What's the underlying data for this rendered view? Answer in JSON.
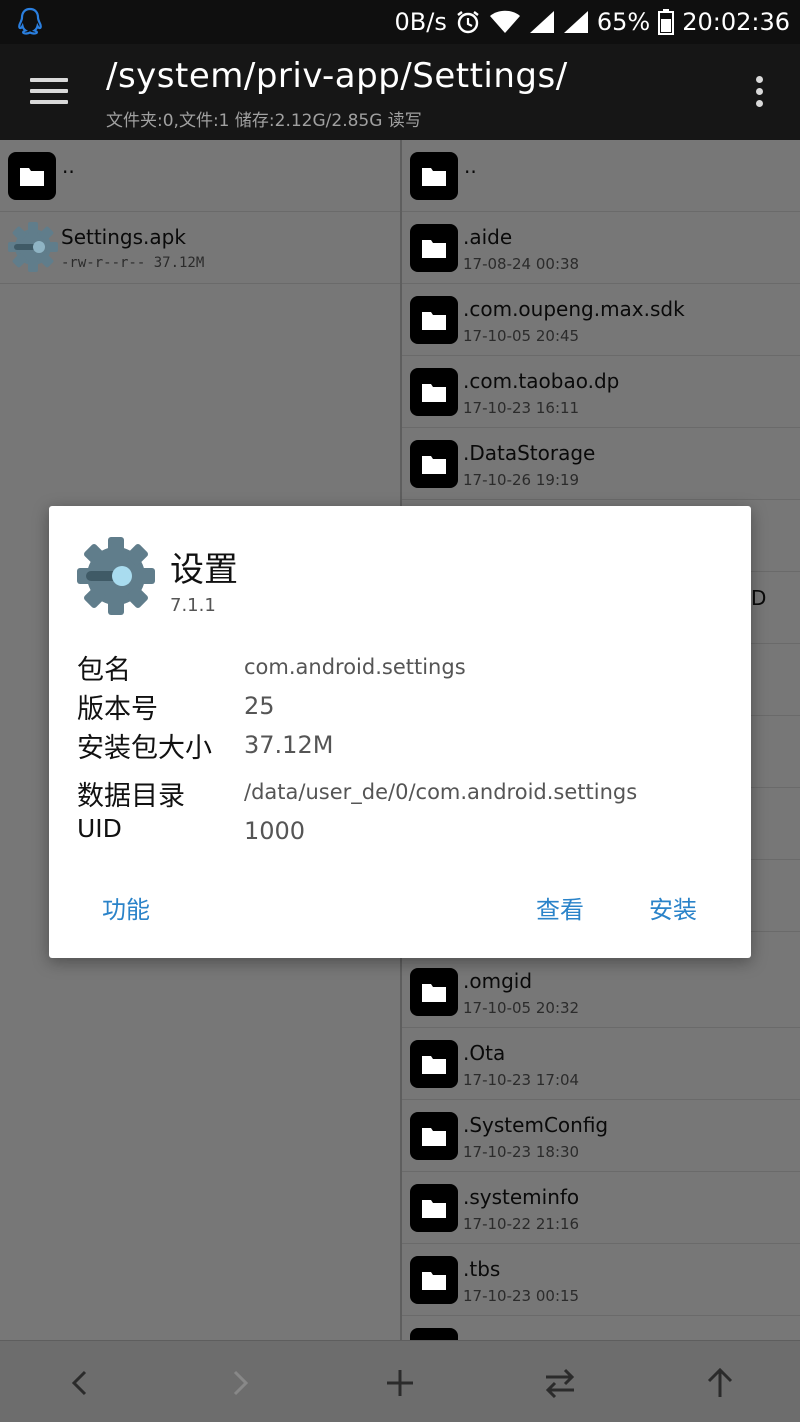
{
  "status_bar": {
    "speed": "0B/s",
    "battery_percent": "65%",
    "time": "20:02:36"
  },
  "toolbar": {
    "path": "/system/priv-app/Settings/",
    "summary": "文件夹:0,文件:1  储存:2.12G/2.85G  读写"
  },
  "left_pane": {
    "parent": "..",
    "files": [
      {
        "name": "Settings.apk",
        "meta": "-rw-r--r--  37.12M"
      }
    ]
  },
  "right_pane": {
    "parent": "..",
    "folders_top": [
      {
        "name": ".aide",
        "date": "17-08-24 00:38"
      },
      {
        "name": ".com.oupeng.max.sdk",
        "date": "17-10-05 20:45"
      },
      {
        "name": ".com.taobao.dp",
        "date": "17-10-23 16:11"
      },
      {
        "name": ".DataStorage",
        "date": "17-10-26 19:19"
      }
    ],
    "partial_char": "D",
    "folders_bottom": [
      {
        "name": ".omgid",
        "date": "17-10-05 20:32"
      },
      {
        "name": ".Ota",
        "date": "17-10-23 17:04"
      },
      {
        "name": ".SystemConfig",
        "date": "17-10-23 18:30"
      },
      {
        "name": ".systeminfo",
        "date": "17-10-22 21:16"
      },
      {
        "name": ".tbs",
        "date": "17-10-23 00:15"
      }
    ]
  },
  "dialog": {
    "app_name": "设置",
    "version": "7.1.1",
    "fields": [
      {
        "label": "包名",
        "value": "com.android.settings"
      },
      {
        "label": "版本号",
        "value": "25"
      },
      {
        "label": "安装包大小",
        "value": "37.12M"
      },
      {
        "label": "数据目录",
        "value": "/data/user_de/0/com.android.settings"
      },
      {
        "label": "UID",
        "value": "1000"
      }
    ],
    "actions": {
      "features": "功能",
      "view": "查看",
      "install": "安装"
    }
  },
  "colors": {
    "accent": "#2a83c9",
    "toolbar": "#161616",
    "statusbar": "#0f0f0f"
  }
}
